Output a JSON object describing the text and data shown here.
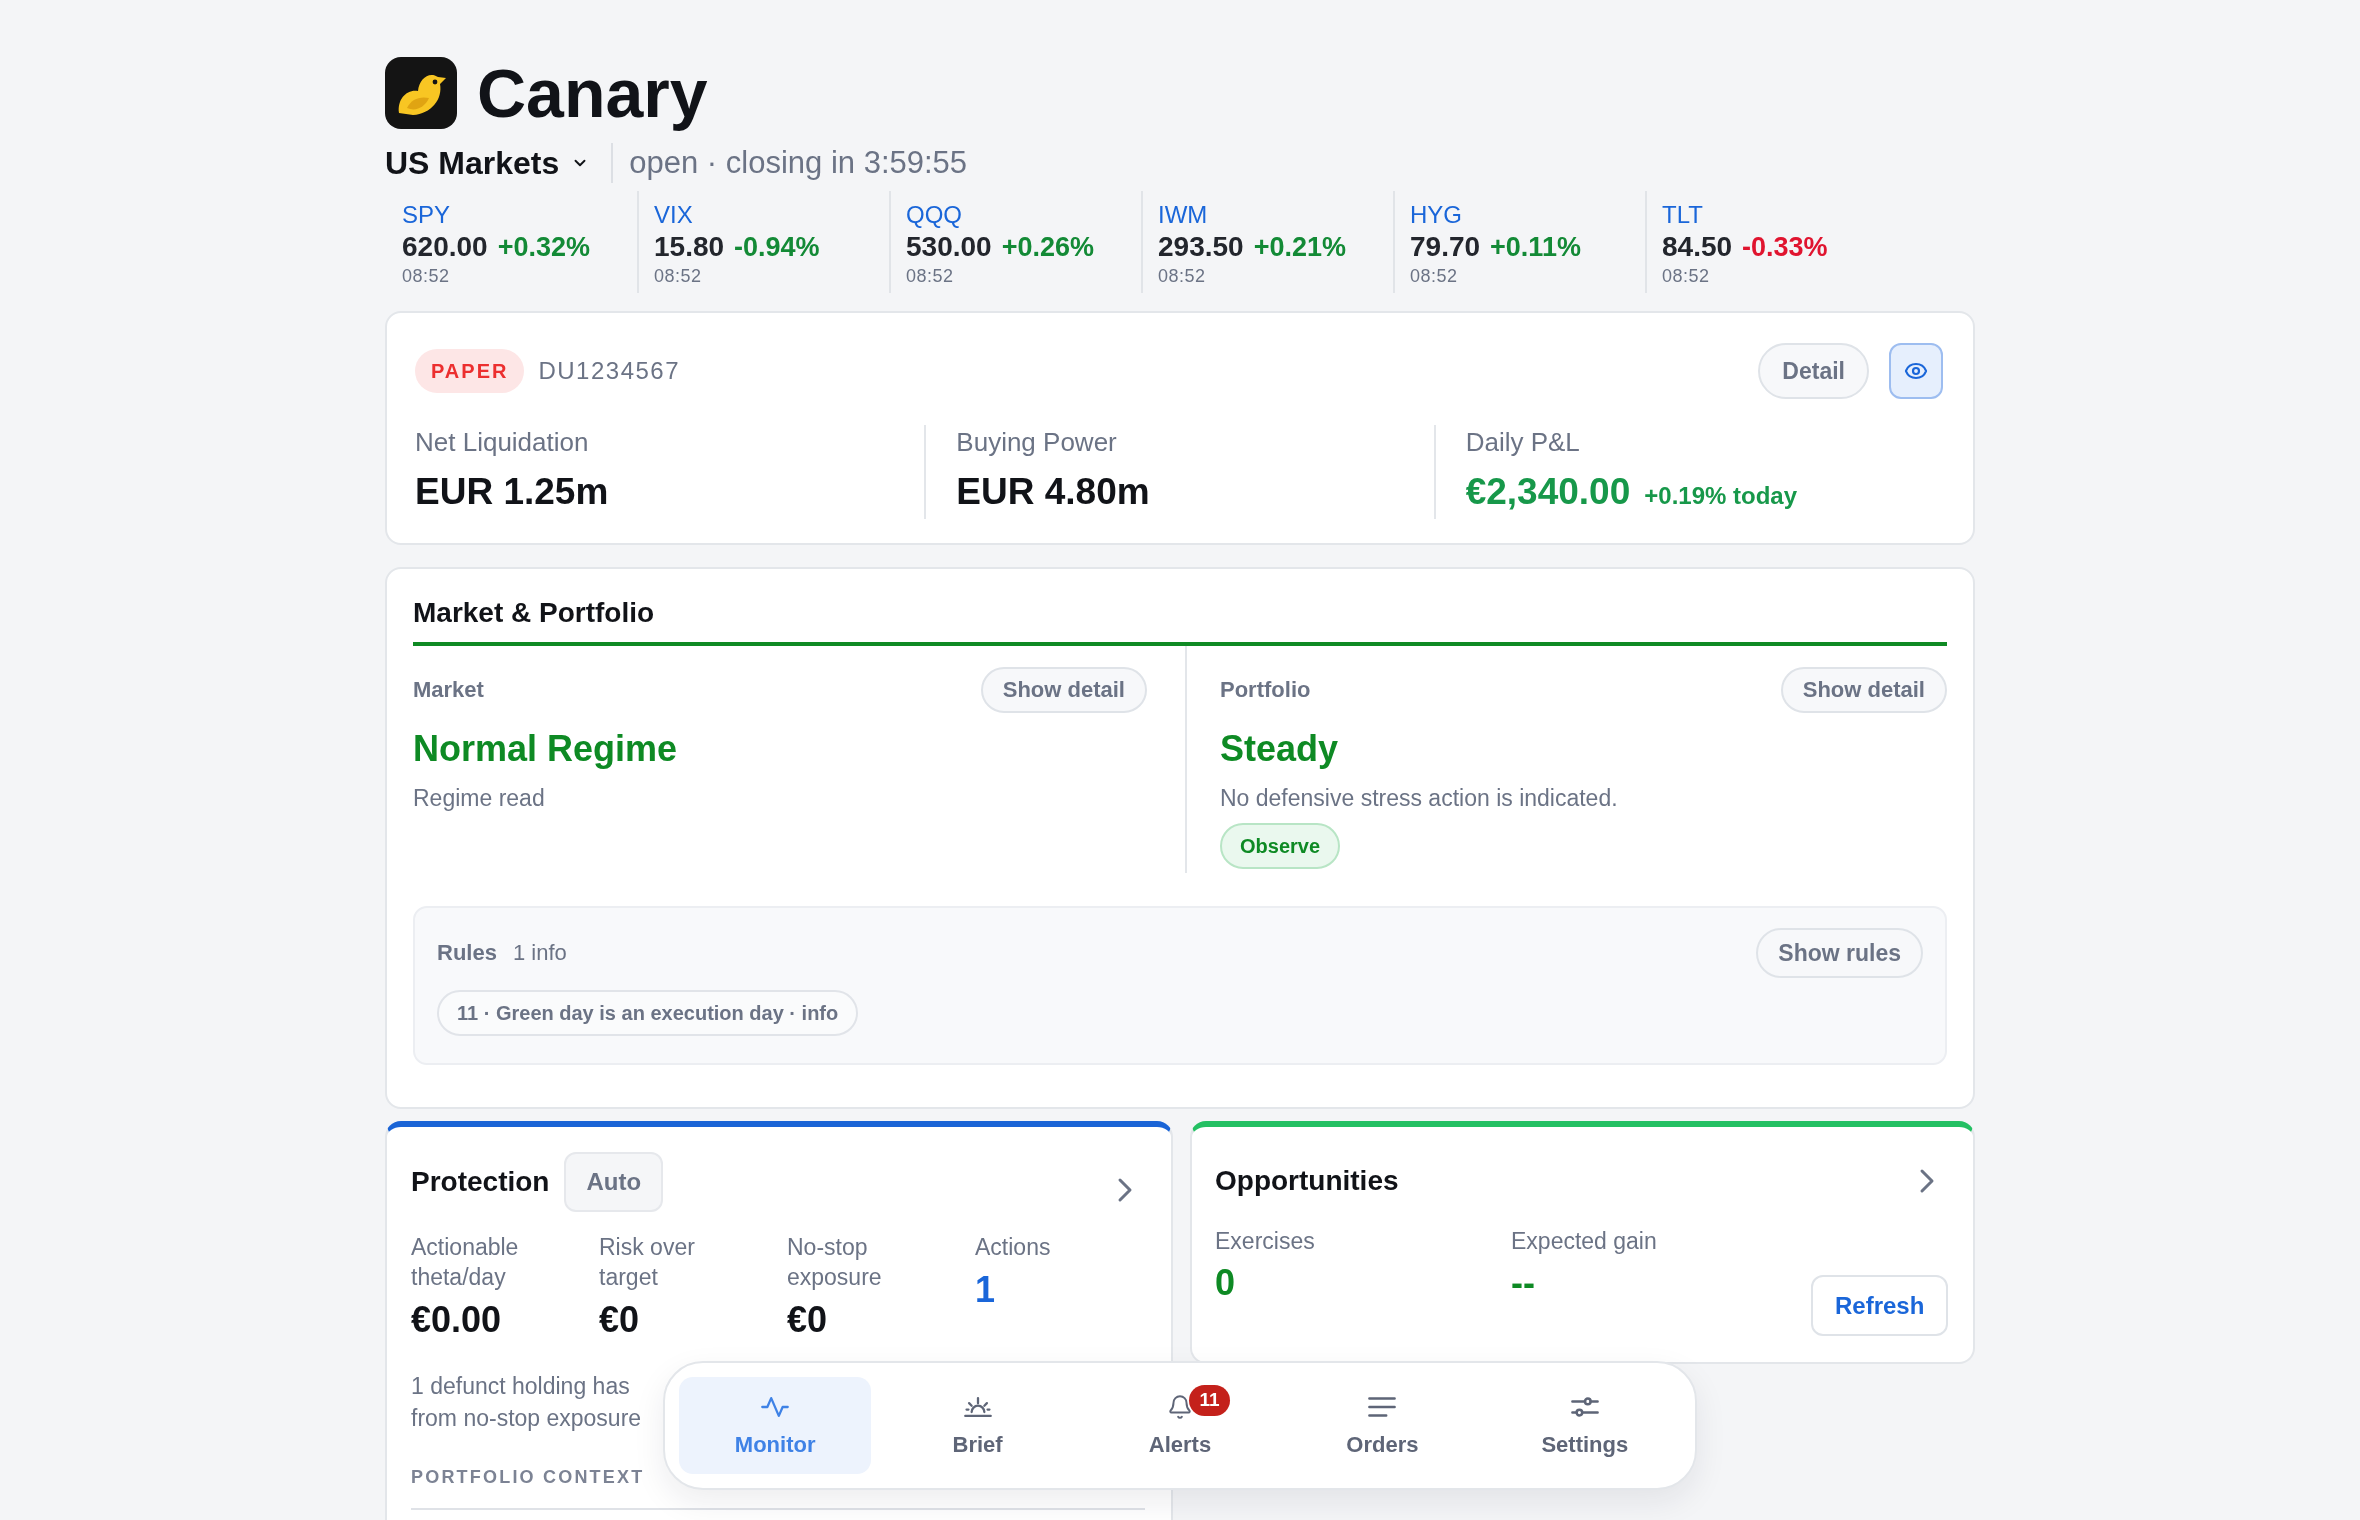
{
  "app": {
    "name": "Canary"
  },
  "market": {
    "selector": "US Markets",
    "status": "open · closing in 3:59:55"
  },
  "tickers": [
    {
      "symbol": "SPY",
      "price": "620.00",
      "change": "+0.32%",
      "color": "#138a36",
      "time": "08:52"
    },
    {
      "symbol": "VIX",
      "price": "15.80",
      "change": "-0.94%",
      "color": "#138a36",
      "time": "08:52"
    },
    {
      "symbol": "QQQ",
      "price": "530.00",
      "change": "+0.26%",
      "color": "#138a36",
      "time": "08:52"
    },
    {
      "symbol": "IWM",
      "price": "293.50",
      "change": "+0.21%",
      "color": "#138a36",
      "time": "08:52"
    },
    {
      "symbol": "HYG",
      "price": "79.70",
      "change": "+0.11%",
      "color": "#138a36",
      "time": "08:52"
    },
    {
      "symbol": "TLT",
      "price": "84.50",
      "change": "-0.33%",
      "color": "#e0142f",
      "time": "08:52"
    }
  ],
  "account": {
    "mode_badge": "PAPER",
    "account_id": "DU1234567",
    "detail_button": "Detail",
    "visibility_toggle": {
      "on": true
    },
    "stats": [
      {
        "label": "Net Liquidation",
        "value": "EUR 1.25m",
        "kind": "money"
      },
      {
        "label": "Buying Power",
        "value": "EUR 4.80m",
        "kind": "money"
      },
      {
        "label": "Daily P&L",
        "value": "€2,340.00",
        "change": "+0.19% today",
        "kind": "gain"
      }
    ]
  },
  "market_portfolio": {
    "title": "Market & Portfolio",
    "panels": [
      {
        "label": "Market",
        "button": "Show detail",
        "status": "Normal Regime",
        "description": "Regime read"
      },
      {
        "label": "Portfolio",
        "button": "Show detail",
        "status": "Steady",
        "description": "No defensive stress action is indicated.",
        "tag": "Observe"
      }
    ],
    "rules": {
      "title": "Rules",
      "count": "1 info",
      "button": "Show rules",
      "items": [
        "11 · Green day is an execution day · info"
      ]
    }
  },
  "protection": {
    "title": "Protection",
    "mode": "Auto",
    "metrics": [
      {
        "label": "Actionable theta/day",
        "value": "€0.00",
        "kind": "money"
      },
      {
        "label": "Risk over target",
        "value": "€0",
        "kind": "money"
      },
      {
        "label": "No-stop exposure",
        "value": "€0",
        "kind": "money"
      },
      {
        "label": "Actions",
        "value": "1",
        "kind": "count"
      }
    ],
    "note_lines": [
      "1 defunct holding has",
      "from no-stop exposure"
    ],
    "section_heading": "PORTFOLIO CONTEXT"
  },
  "opportunities": {
    "title": "Opportunities",
    "metrics": [
      {
        "label": "Exercises",
        "value": "0",
        "kind": "gain"
      },
      {
        "label": "Expected gain",
        "value": "--",
        "kind": "gain"
      }
    ],
    "button": "Refresh"
  },
  "bottom_nav": {
    "items": [
      {
        "label": "Monitor",
        "selected": true
      },
      {
        "label": "Brief",
        "selected": false
      },
      {
        "label": "Alerts",
        "selected": false,
        "badge": "11"
      },
      {
        "label": "Orders",
        "selected": false
      },
      {
        "label": "Settings",
        "selected": false
      }
    ]
  }
}
